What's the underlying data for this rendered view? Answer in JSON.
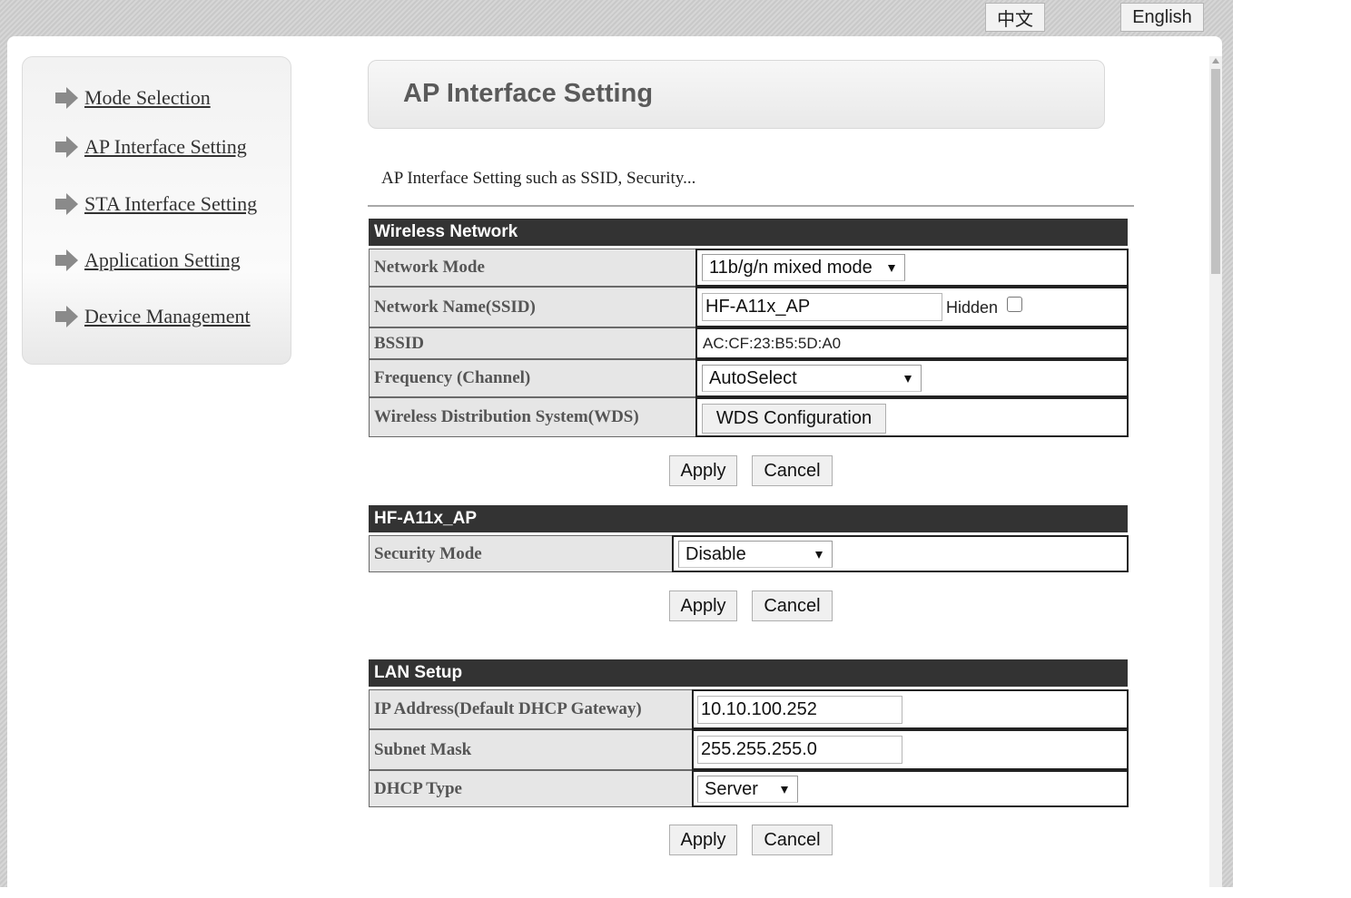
{
  "lang": {
    "zh": "中文",
    "en": "English"
  },
  "sidebar": {
    "items": [
      {
        "label": "Mode Selection"
      },
      {
        "label": "AP Interface Setting"
      },
      {
        "label": "STA Interface Setting"
      },
      {
        "label": "Application Setting"
      },
      {
        "label": "Device Management"
      }
    ]
  },
  "page": {
    "title": "AP Interface Setting",
    "description": "AP Interface Setting such as SSID, Security..."
  },
  "wireless": {
    "header": "Wireless Network",
    "network_mode_label": "Network Mode",
    "network_mode_value": "11b/g/n mixed mode",
    "ssid_label": "Network Name(SSID)",
    "ssid_value": "HF-A11x_AP",
    "hidden_label": "Hidden",
    "hidden_checked": false,
    "bssid_label": "BSSID",
    "bssid_value": "AC:CF:23:B5:5D:A0",
    "frequency_label": "Frequency (Channel)",
    "frequency_value": "AutoSelect",
    "wds_label": "Wireless Distribution System(WDS)",
    "wds_button": "WDS Configuration"
  },
  "security": {
    "header": "HF-A11x_AP",
    "mode_label": "Security Mode",
    "mode_value": "Disable"
  },
  "lan": {
    "header": "LAN Setup",
    "ip_label": "IP Address(Default DHCP Gateway)",
    "ip_value": "10.10.100.252",
    "mask_label": "Subnet Mask",
    "mask_value": "255.255.255.0",
    "dhcp_label": "DHCP Type",
    "dhcp_value": "Server"
  },
  "buttons": {
    "apply": "Apply",
    "cancel": "Cancel"
  }
}
